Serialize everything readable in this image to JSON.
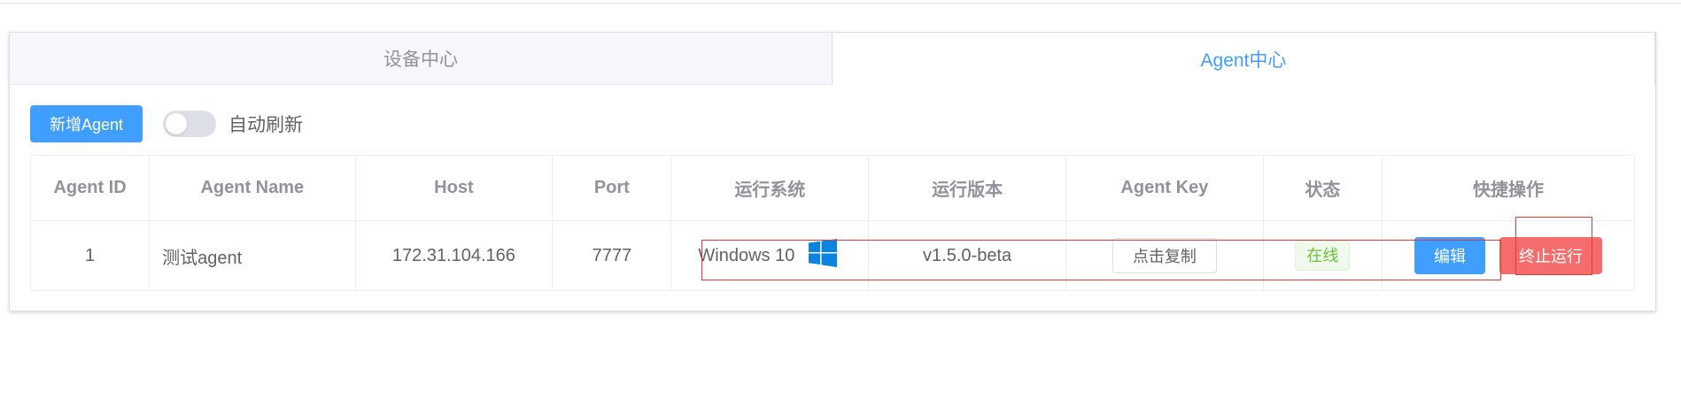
{
  "tabs": [
    {
      "label": "设备中心",
      "active": false
    },
    {
      "label": "Agent中心",
      "active": true
    }
  ],
  "toolbar": {
    "add_label": "新增Agent",
    "auto_refresh_label": "自动刷新",
    "auto_refresh_on": false
  },
  "table": {
    "headers": [
      "Agent ID",
      "Agent Name",
      "Host",
      "Port",
      "运行系统",
      "运行版本",
      "Agent Key",
      "状态",
      "快捷操作"
    ],
    "rows": [
      {
        "id": "1",
        "name": "测试agent",
        "host": "172.31.104.166",
        "port": "7777",
        "os": "Windows 10",
        "os_icon": "windows-icon",
        "version": "v1.5.0-beta",
        "key_button": "点击复制",
        "status": "在线",
        "edit_label": "编辑",
        "stop_label": "终止运行"
      }
    ]
  },
  "colors": {
    "primary": "#409eff",
    "danger": "#f56c6c",
    "success": "#67c23a",
    "highlight_box": "#e53935"
  }
}
